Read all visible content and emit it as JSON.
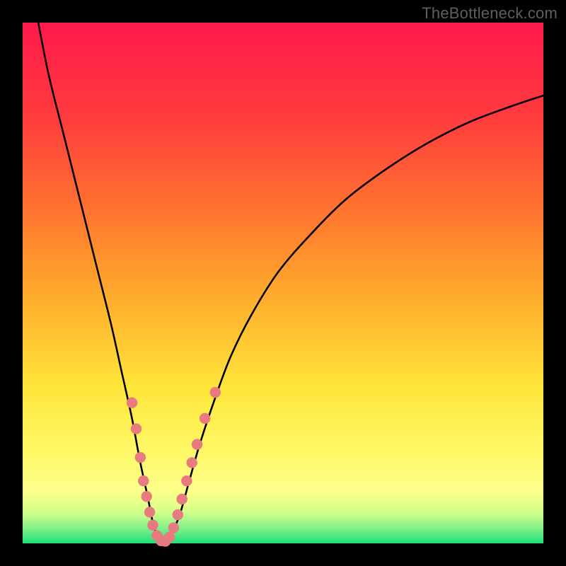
{
  "watermark": "TheBottleneck.com",
  "chart_data": {
    "type": "line",
    "title": "",
    "xlabel": "",
    "ylabel": "",
    "xlim": [
      0,
      100
    ],
    "ylim": [
      0,
      100
    ],
    "grid": false,
    "legend": null,
    "gradient_stops": [
      {
        "pct": 0,
        "color": "#ff1a4b"
      },
      {
        "pct": 18,
        "color": "#ff3b3e"
      },
      {
        "pct": 38,
        "color": "#ff7a2e"
      },
      {
        "pct": 55,
        "color": "#ffb42e"
      },
      {
        "pct": 70,
        "color": "#ffe53a"
      },
      {
        "pct": 82,
        "color": "#fff866"
      },
      {
        "pct": 90,
        "color": "#fdff8a"
      },
      {
        "pct": 94,
        "color": "#d4ff8a"
      },
      {
        "pct": 97,
        "color": "#86f08a"
      },
      {
        "pct": 100,
        "color": "#1fe07a"
      }
    ],
    "series": [
      {
        "name": "bottleneck-curve",
        "x": [
          3,
          5,
          8,
          11,
          14,
          17,
          19,
          21,
          22.5,
          24,
          25,
          26,
          27,
          28,
          30,
          32,
          34,
          37,
          40,
          44,
          49,
          55,
          62,
          70,
          78,
          86,
          94,
          100
        ],
        "y": [
          100,
          90,
          78,
          66,
          54,
          42,
          33,
          24,
          16,
          9,
          4,
          1,
          0,
          1,
          5,
          12,
          19,
          28,
          36,
          44,
          52,
          59,
          66,
          72,
          77,
          81,
          84,
          86
        ]
      }
    ],
    "markers": [
      {
        "x": 21.0,
        "y": 27.0
      },
      {
        "x": 21.8,
        "y": 22.0
      },
      {
        "x": 22.6,
        "y": 16.5
      },
      {
        "x": 23.2,
        "y": 12.0
      },
      {
        "x": 23.8,
        "y": 9.0
      },
      {
        "x": 24.4,
        "y": 6.0
      },
      {
        "x": 25.0,
        "y": 3.5
      },
      {
        "x": 25.8,
        "y": 1.5
      },
      {
        "x": 26.6,
        "y": 0.5
      },
      {
        "x": 27.4,
        "y": 0.4
      },
      {
        "x": 28.2,
        "y": 1.2
      },
      {
        "x": 29.0,
        "y": 3.0
      },
      {
        "x": 29.8,
        "y": 5.5
      },
      {
        "x": 30.6,
        "y": 8.5
      },
      {
        "x": 31.5,
        "y": 12.0
      },
      {
        "x": 32.5,
        "y": 15.5
      },
      {
        "x": 33.5,
        "y": 19.0
      },
      {
        "x": 35.0,
        "y": 24.0
      },
      {
        "x": 37.0,
        "y": 29.0
      }
    ],
    "marker_color": "#e77b80",
    "curve_color": "#000000"
  }
}
